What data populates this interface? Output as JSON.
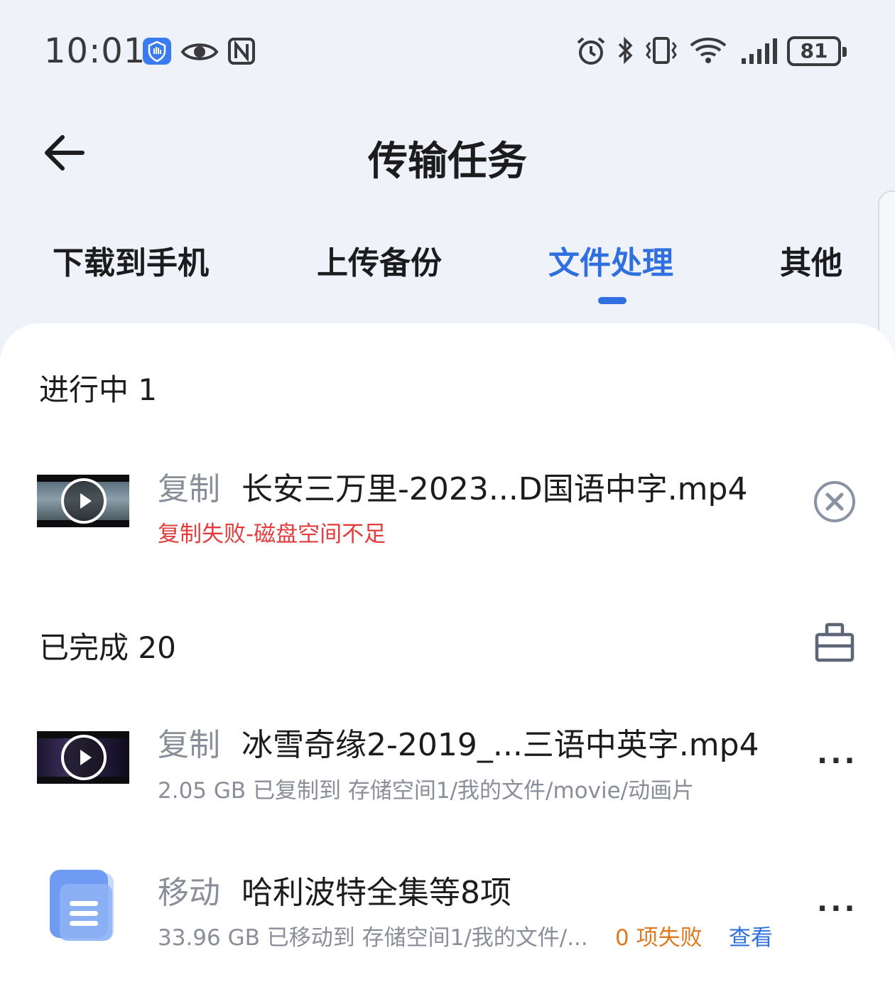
{
  "status_bar": {
    "time": "10:01",
    "icons": [
      "hand-shield-icon",
      "eye-icon",
      "nfc-icon",
      "alarm-icon",
      "bluetooth-icon",
      "vibrate-icon",
      "wifi-icon",
      "signal-icon"
    ],
    "battery": "81"
  },
  "header": {
    "title": "传输任务",
    "back_icon": "back-arrow-icon"
  },
  "tabs": [
    {
      "label": "下载到手机",
      "active": false
    },
    {
      "label": "上传备份",
      "active": false
    },
    {
      "label": "文件处理",
      "active": true
    },
    {
      "label": "其他",
      "active": false
    }
  ],
  "colors": {
    "accent": "#2f6fe0",
    "error": "#e23c3c",
    "warning": "#e07a1f",
    "muted": "#8a8e99",
    "background": "#eff2f8"
  },
  "in_progress": {
    "title": "进行中 1",
    "items": [
      {
        "operation": "复制",
        "name": "长安三万里-2023...D国语中字.mp4",
        "status": "复制失败-磁盘空间不足"
      }
    ]
  },
  "completed": {
    "title": "已完成 20",
    "items": [
      {
        "operation": "复制",
        "name": "冰雪奇缘2-2019_...三语中英字.mp4",
        "detail": "2.05 GB 已复制到 存储空间1/我的文件/movie/动画片"
      },
      {
        "operation": "移动",
        "name": "哈利波特全集等8项",
        "detail": "33.96 GB 已移动到 存储空间1/我的文件/...",
        "fail_text": "0 项失败",
        "view_label": "查看"
      }
    ]
  },
  "more_label": "..."
}
